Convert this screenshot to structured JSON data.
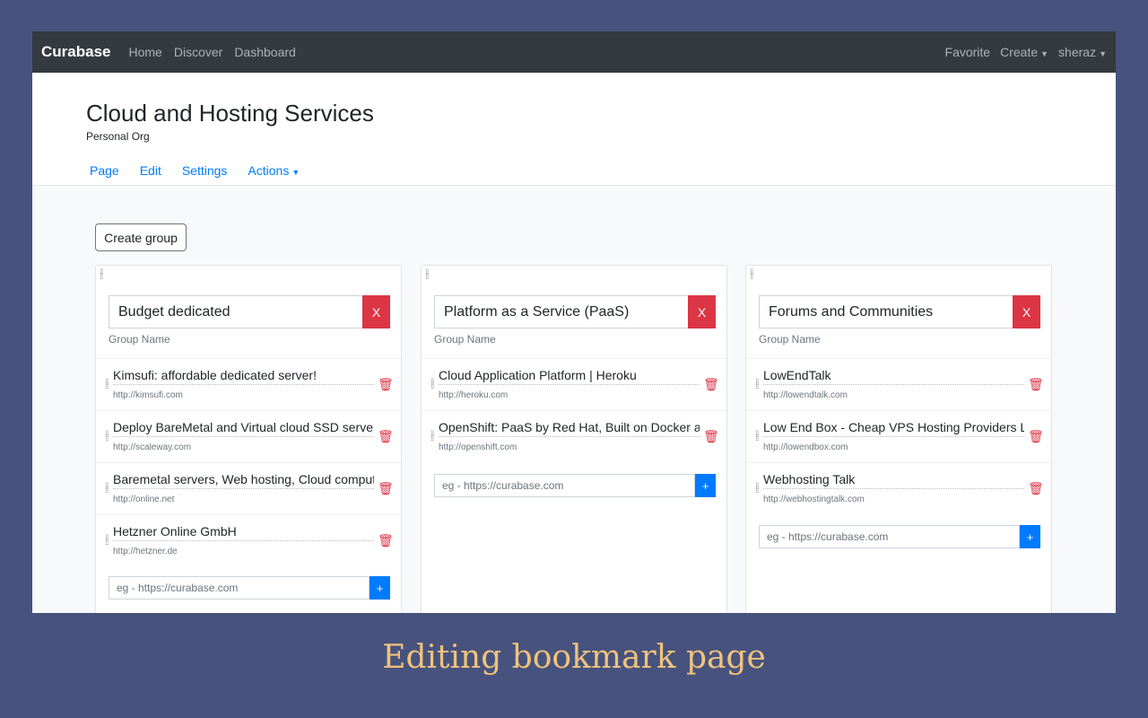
{
  "navbar": {
    "brand": "Curabase",
    "left_links": [
      "Home",
      "Discover",
      "Dashboard"
    ],
    "favorite": "Favorite",
    "create": "Create",
    "user": "sheraz"
  },
  "header": {
    "title": "Cloud and Hosting Services",
    "subtitle": "Personal Org",
    "tabs": [
      "Page",
      "Edit",
      "Settings",
      "Actions"
    ]
  },
  "create_group_label": "Create group",
  "group_name_help": "Group Name",
  "remove_label": "X",
  "add_placeholder": "eg - https://curabase.com",
  "add_label": "+",
  "groups": [
    {
      "name": "Budget dedicated",
      "links": [
        {
          "title": "Kimsufi: affordable dedicated server!",
          "url": "http://kimsufi.com"
        },
        {
          "title": "Deploy BareMetal and Virtual cloud SSD server",
          "url": "http://scaleway.com"
        },
        {
          "title": "Baremetal servers, Web hosting, Cloud computi",
          "url": "http://online.net"
        },
        {
          "title": "Hetzner Online GmbH",
          "url": "http://hetzner.de"
        }
      ]
    },
    {
      "name": "Platform as a Service (PaaS)",
      "links": [
        {
          "title": "Cloud Application Platform | Heroku",
          "url": "http://heroku.com"
        },
        {
          "title": "OpenShift: PaaS by Red Hat, Built on Docker an",
          "url": "http://openshift.com"
        }
      ]
    },
    {
      "name": "Forums and Communities",
      "links": [
        {
          "title": "LowEndTalk",
          "url": "http://lowendtalk.com"
        },
        {
          "title": "Low End Box - Cheap VPS Hosting Providers Lis",
          "url": "http://lowendbox.com"
        },
        {
          "title": "Webhosting Talk",
          "url": "http://webhostingtalk.com"
        }
      ]
    }
  ],
  "caption": "Editing bookmark page"
}
